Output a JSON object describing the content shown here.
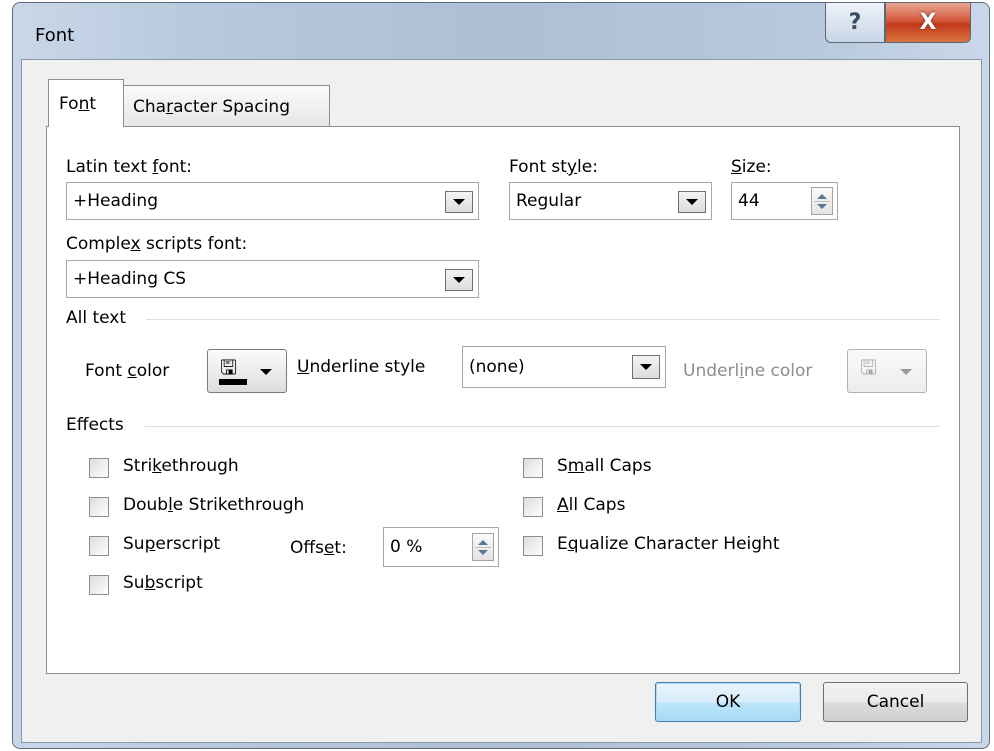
{
  "window": {
    "title": "Font",
    "help_glyph": "?",
    "close_glyph": "X"
  },
  "tabs": [
    {
      "pre": "Fo",
      "key": "n",
      "post": "t"
    },
    {
      "pre": "Cha",
      "key": "r",
      "post": "acter Spacing"
    }
  ],
  "latin_font": {
    "label_pre": "Latin text ",
    "label_key": "f",
    "label_post": "ont:",
    "value": "+Heading"
  },
  "font_style": {
    "label_pre": "Font st",
    "label_key": "y",
    "label_post": "le:",
    "value": "Regular"
  },
  "size": {
    "label_pre": "",
    "label_key": "S",
    "label_post": "ize:",
    "value": "44"
  },
  "complex_font": {
    "label_pre": "Comple",
    "label_key": "x",
    "label_post": " scripts font:",
    "value": "+Heading CS"
  },
  "all_text": {
    "heading": "All text",
    "font_color": {
      "label_pre": "Font ",
      "label_key": "c",
      "label_post": "olor"
    },
    "underline_style": {
      "label_pre": "",
      "label_key": "U",
      "label_post": "nderline style",
      "value": "(none)"
    },
    "underline_color": {
      "label_pre": "Underl",
      "label_key": "i",
      "label_post": "ne color"
    }
  },
  "effects": {
    "heading": "Effects",
    "strikethrough": {
      "pre": "Stri",
      "key": "k",
      "post": "ethrough"
    },
    "double_strikethrough": {
      "pre": "Doub",
      "key": "l",
      "post": "e Strikethrough"
    },
    "superscript": {
      "pre": "Su",
      "key": "p",
      "post": "erscript"
    },
    "subscript": {
      "pre": "Su",
      "key": "b",
      "post": "script"
    },
    "offset": {
      "label_pre": "Offs",
      "label_key": "e",
      "label_post": "t:",
      "value": "0 %"
    },
    "small_caps": {
      "pre": "S",
      "key": "m",
      "post": "all Caps"
    },
    "all_caps": {
      "pre": "",
      "key": "A",
      "post": "ll Caps"
    },
    "equalize": {
      "pre": "E",
      "key": "q",
      "post": "ualize Character Height"
    }
  },
  "buttons": {
    "ok": "OK",
    "cancel": "Cancel"
  },
  "colors": {
    "font_color_swatch": "#000000",
    "accent": "#3c7fb1"
  }
}
